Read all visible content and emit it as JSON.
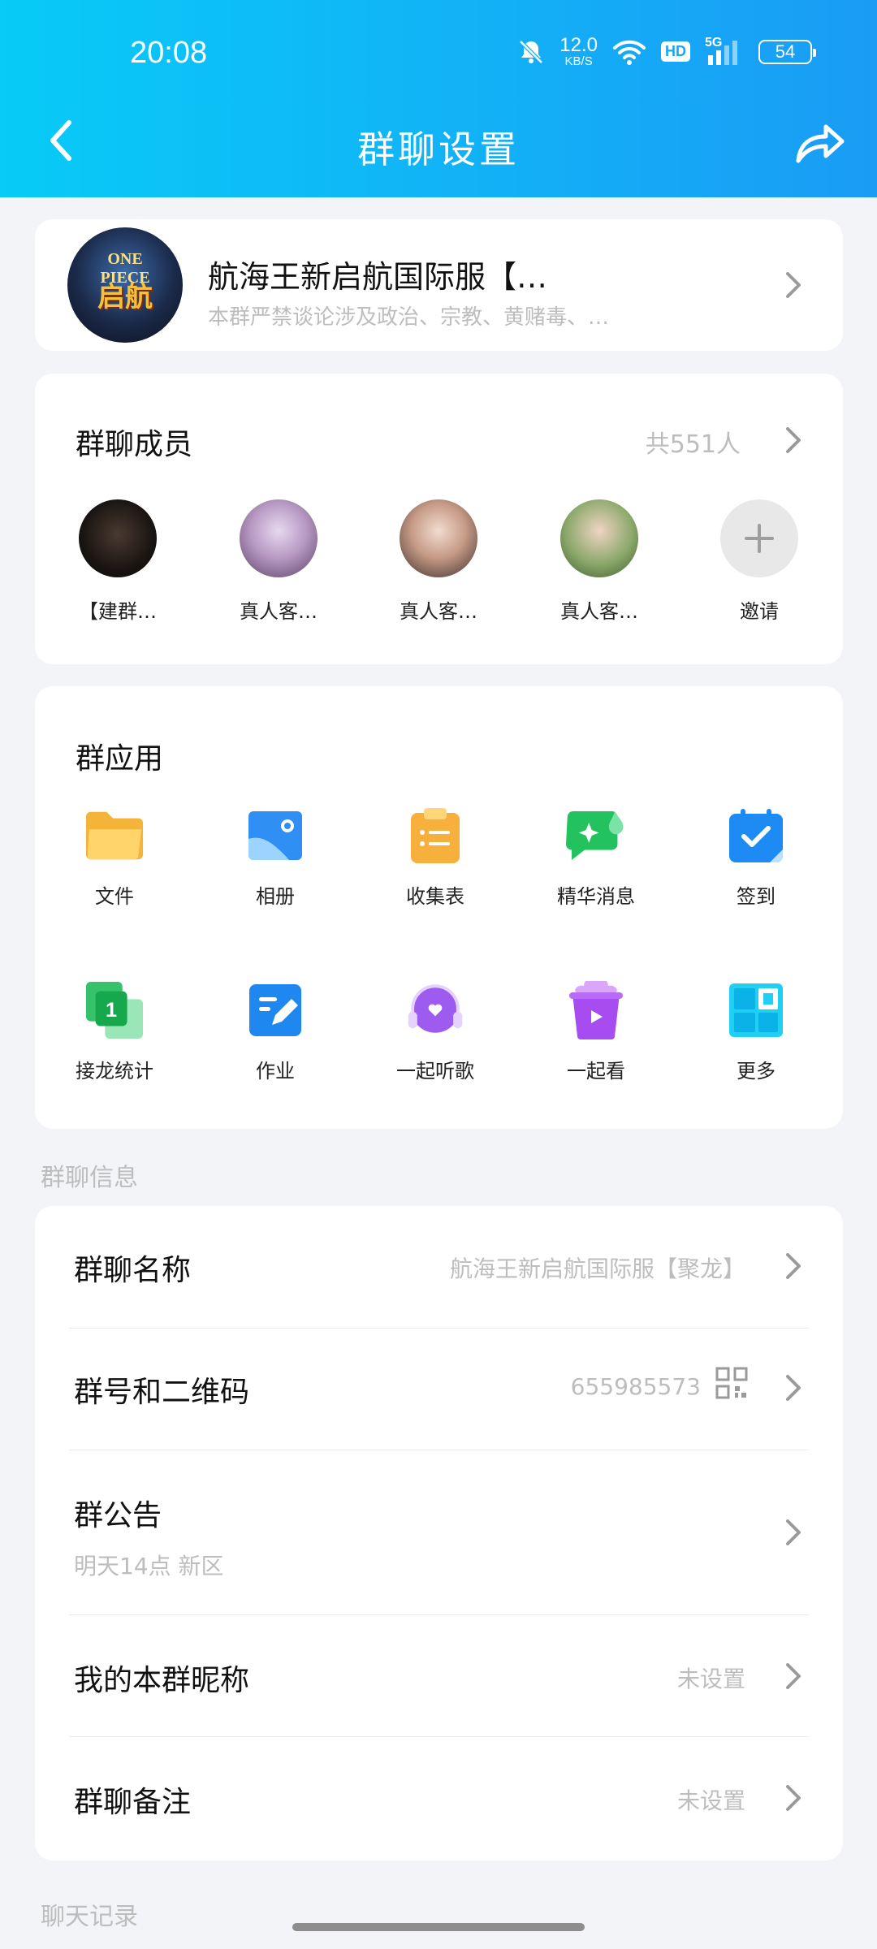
{
  "status_bar": {
    "time": "20:08",
    "net_speed_value": "12.0",
    "net_speed_unit": "KB/S",
    "hd_label": "HD",
    "network_label": "5G",
    "battery": "54"
  },
  "header": {
    "title": "群聊设置"
  },
  "group": {
    "avatar_top_text": "ONE PIECE",
    "avatar_text": "启航",
    "name": "航海王新启航国际服【…",
    "description": "本群严禁谈论涉及政治、宗教、黄赌毒、…"
  },
  "members": {
    "title": "群聊成员",
    "count": "共551人",
    "items": [
      {
        "name": "【建群…"
      },
      {
        "name": "真人客…"
      },
      {
        "name": "真人客…"
      },
      {
        "name": "真人客…"
      },
      {
        "name": "邀请"
      }
    ]
  },
  "apps": {
    "title": "群应用",
    "items": [
      {
        "label": "文件",
        "icon": "folder-icon"
      },
      {
        "label": "相册",
        "icon": "photo-album-icon"
      },
      {
        "label": "收集表",
        "icon": "clipboard-icon"
      },
      {
        "label": "精华消息",
        "icon": "essence-message-icon"
      },
      {
        "label": "签到",
        "icon": "calendar-checkin-icon"
      },
      {
        "label": "接龙统计",
        "icon": "relay-stats-icon"
      },
      {
        "label": "作业",
        "icon": "homework-icon"
      },
      {
        "label": "一起听歌",
        "icon": "listen-together-icon"
      },
      {
        "label": "一起看",
        "icon": "watch-together-icon"
      },
      {
        "label": "更多",
        "icon": "more-grid-icon"
      }
    ]
  },
  "group_info": {
    "heading": "群聊信息",
    "name_label": "群聊名称",
    "name_value": "航海王新启航国际服【聚龙】",
    "id_label": "群号和二维码",
    "id_value": "655985573",
    "notice_label": "群公告",
    "notice_value": "明天14点 新区",
    "nickname_label": "我的本群昵称",
    "nickname_value": "未设置",
    "remark_label": "群聊备注",
    "remark_value": "未设置"
  },
  "bottom": {
    "peek_label": "聊天记录"
  },
  "colors": {
    "header_start": "#08CBF7",
    "header_end": "#1A9CF5",
    "background": "#F3F4F7",
    "muted_text": "#BDBDBD"
  }
}
